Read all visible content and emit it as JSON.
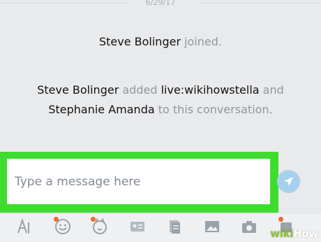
{
  "conversation": {
    "date_separator": "6/29/17",
    "events": [
      {
        "actor": "Steve Bolinger",
        "verb": "joined."
      },
      {
        "actor": "Steve Bolinger",
        "verb": "added",
        "target": "live:wikihowstella",
        "conj": "and",
        "target2": "Stephanie Amanda",
        "tail": "to this conversation."
      }
    ]
  },
  "composer": {
    "placeholder": "Type a message here",
    "highlight_color": "#3ddc2e"
  },
  "toolbar": {
    "icons": [
      "text-format-icon",
      "emoticon-icon",
      "mojis-icon",
      "contact-card-icon",
      "file-icon",
      "photo-icon",
      "camera-icon",
      "more-icon"
    ],
    "notification_dot_color": "#ed6a2b"
  },
  "watermark": {
    "prefix": "wiki",
    "suffix": "How"
  }
}
